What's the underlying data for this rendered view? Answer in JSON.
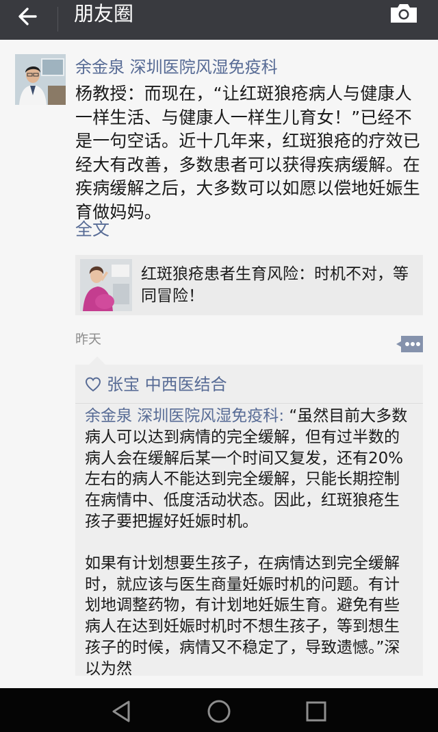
{
  "header": {
    "title": "朋友圈"
  },
  "post": {
    "author": "余金泉 深圳医院风湿免疫科",
    "text": "杨教授：而现在，“让红斑狼疮病人与健康人一样生活、与健康人一样生儿育女！”已经不是一句空话。近十几年来，红斑狼疮的疗效已经大有改善，多数患者可以获得疾病缓解。在疾病缓解之后，大多数可以如愿以偿地妊娠生育做妈妈。",
    "full_text_link": "全文",
    "link_card": {
      "title": "红斑狼疮患者生育风险：时机不对，等同冒险！"
    },
    "timestamp": "昨天"
  },
  "interactions": {
    "likes": [
      "张宝 中西医结合"
    ],
    "comment": {
      "author": "余金泉 深圳医院风湿免疫科",
      "separator": ": ",
      "paragraph1": "“虽然目前大多数病人可以达到病情的完全缓解，但有过半数的病人会在缓解后某一个时间又复发，还有20%左右的病人不能达到完全缓解，只能长期控制在病情中、低度活动状态。因此，红斑狼疮生孩子要把握好妊娠时机。",
      "paragraph2": "如果有计划想要生孩子，在病情达到完全缓解时，就应该与医生商量妊娠时机的问题。有计划地调整药物，有计划地妊娠生育。避免有些病人在达到妊娠时机时不想生孩子，等到想生孩子的时候，病情又不稳定了，导致遗憾。”深以为然"
    }
  },
  "icons": {
    "back": "arrow-left-icon",
    "camera": "camera-icon",
    "comment": "comment-dots-icon",
    "like": "heart-outline-icon",
    "nav_back": "triangle-back-icon",
    "nav_home": "circle-home-icon",
    "nav_recents": "square-recents-icon"
  },
  "colors": {
    "header_bg": "#393a3f",
    "link_blue": "#576b95",
    "page_bg": "#f6f6f6",
    "comment_bg": "#eeeeee",
    "navbar_bg": "#050505"
  }
}
